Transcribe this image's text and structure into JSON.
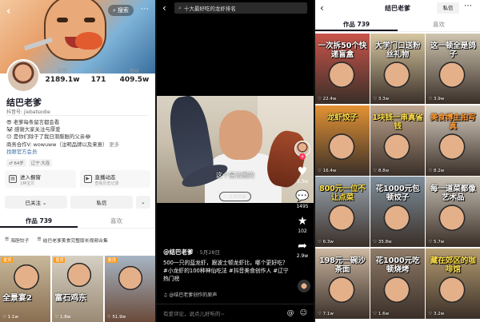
{
  "profile": {
    "search_label": "搜索",
    "stats": [
      {
        "label": "获赞",
        "value": "2189.1w"
      },
      {
        "label": "关注",
        "value": "171"
      },
      {
        "label": "粉丝",
        "value": "409.5w"
      }
    ],
    "name": "结巴老爹",
    "id_line": "抖音号: jiebatsodie",
    "bio": [
      "😎 老爹每条留言都会看",
      "🐼 感谢大家关注与厚爱",
      "😑 是你们除于了我日渐膨胀的父亲😂",
      "商务合作V: wowuww（注明品牌以及来意）"
    ],
    "bio_more": "更多",
    "bio_link": "找眼官方会员",
    "tags": [
      "♂ 64岁",
      "辽宁·大连"
    ],
    "services": [
      {
        "title": "进入橱窗",
        "subtitle": "1种宝贝"
      },
      {
        "title": "直播动态",
        "subtitle": "查看历史记录"
      }
    ],
    "follow_label": "已关注 ⌄",
    "message_label": "私信",
    "dropdown_label": "⌄",
    "tabs": [
      "作品 739",
      "喜欢"
    ],
    "collections": [
      "海胆饺子",
      "结巴老爹美食完整版长视频合集"
    ],
    "videos": [
      {
        "badge": "置顶",
        "caption": "全景宴2",
        "likes": "♡ 1.1w"
      },
      {
        "badge": "置顶",
        "caption": "富石鸡东",
        "likes": "♡ 1.8w"
      },
      {
        "badge": "置顶",
        "caption": "",
        "likes": "♡ 51.9w"
      }
    ]
  },
  "video": {
    "search_query": "十大最好吃的龙虾排名",
    "subtitle": "这个是法国的",
    "fullscreen_label": "全屏观看",
    "actions": [
      {
        "glyph": "♥",
        "count": "3.3w"
      },
      {
        "glyph": "💬",
        "count": "1495"
      },
      {
        "glyph": "★",
        "count": "102"
      },
      {
        "glyph": "➦",
        "count": "2.9w"
      }
    ],
    "author": "@结巴老爹",
    "date": "· 5月28日",
    "description": "500一只的蓝龙虾，跟波士顿龙虾比，哪个更好吃？ #小龙虾的100种神仙吃法 #抖音美食创作人 #辽宁热门榜",
    "music": "♫ @结巴老爹创作的原声",
    "comment_placeholder": "有爱评论，说点儿好听的~",
    "comment_icons": [
      "@",
      "☺"
    ]
  },
  "grid": {
    "title": "结巴老爹",
    "message_label": "私信",
    "tabs": [
      "作品 739",
      "喜欢"
    ],
    "cells": [
      {
        "caption": "一次拆50个快递盲盒",
        "likes": "♡ 22.4w",
        "color": "#ffffff",
        "bg": "#c9544a"
      },
      {
        "caption": "大学门口送粉丝礼物",
        "likes": "♡ 3.3w",
        "color": "#ffffff",
        "bg": "#d6c7a1"
      },
      {
        "caption": "这一顿全是鸽子",
        "likes": "♡ 3.9w",
        "color": "#ffffff",
        "bg": "#cfc5b0"
      },
      {
        "caption": "龙虾饺子",
        "likes": "♡ 16.4w",
        "color": "#ffe14a",
        "bg": "#e49334"
      },
      {
        "caption": "1块钱一串真省钱",
        "likes": "♡ 8.8w",
        "color": "#ffe14a",
        "bg": "#bfa58e"
      },
      {
        "caption": "美食博主拍写真",
        "likes": "♡ 8.2w",
        "color": "#ff9933",
        "bg": "#d9d0c2"
      },
      {
        "caption": "800元一位不让点菜",
        "likes": "♡ 6.3w",
        "color": "#ffe14a",
        "bg": "#9aa6b1"
      },
      {
        "caption": "花1000元包顿饺子",
        "likes": "♡ 35.8w",
        "color": "#ffffff",
        "bg": "#7f8f9c"
      },
      {
        "caption": "每一道菜都像艺术品",
        "likes": "♡ 5.7w",
        "color": "#ffffff",
        "bg": "#c8c0b4"
      },
      {
        "caption": "198元一碗沙茶面",
        "likes": "♡ 7.1w",
        "color": "#ffffff",
        "bg": "#cdb8a2"
      },
      {
        "caption": "花1000元吃顿烧烤",
        "likes": "♡ 1.6w",
        "color": "#ffffff",
        "bg": "#8f7b68"
      },
      {
        "caption": "藏在郊区的咖啡馆",
        "likes": "♡ 3.2w",
        "color": "#ffe14a",
        "bg": "#b79e72"
      }
    ]
  }
}
